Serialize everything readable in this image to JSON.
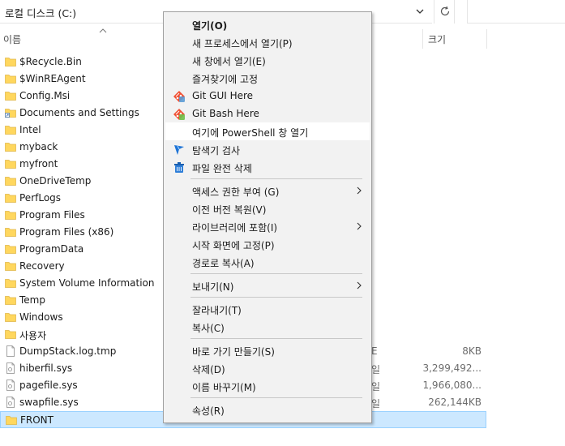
{
  "address": {
    "path": "로컬 디스크 (C:)"
  },
  "columns": {
    "name": "이름",
    "size": "크기"
  },
  "files": [
    {
      "name": "$Recycle.Bin",
      "kind": "folder"
    },
    {
      "name": "$WinREAgent",
      "kind": "folder"
    },
    {
      "name": "Config.Msi",
      "kind": "folder"
    },
    {
      "name": "Documents and Settings",
      "kind": "shortcut-folder"
    },
    {
      "name": "Intel",
      "kind": "folder"
    },
    {
      "name": "myback",
      "kind": "folder"
    },
    {
      "name": "myfront",
      "kind": "folder"
    },
    {
      "name": "OneDriveTemp",
      "kind": "folder"
    },
    {
      "name": "PerfLogs",
      "kind": "folder"
    },
    {
      "name": "Program Files",
      "kind": "folder"
    },
    {
      "name": "Program Files (x86)",
      "kind": "folder"
    },
    {
      "name": "ProgramData",
      "kind": "folder"
    },
    {
      "name": "Recovery",
      "kind": "folder"
    },
    {
      "name": "System Volume Information",
      "kind": "folder"
    },
    {
      "name": "Temp",
      "kind": "folder"
    },
    {
      "name": "Windows",
      "kind": "folder"
    },
    {
      "name": "사용자",
      "kind": "folder"
    },
    {
      "name": "DumpStack.log.tmp",
      "kind": "file",
      "type": "E",
      "size": "8KB"
    },
    {
      "name": "hiberfil.sys",
      "kind": "sysfile",
      "type": "일",
      "size": "3,299,492..."
    },
    {
      "name": "pagefile.sys",
      "kind": "sysfile",
      "type": "일",
      "size": "1,966,080..."
    },
    {
      "name": "swapfile.sys",
      "kind": "sysfile",
      "type": "일",
      "size": "262,144KB"
    },
    {
      "name": "FRONT",
      "kind": "folder",
      "selected": true
    }
  ],
  "context_menu": {
    "items": [
      {
        "label": "열기(O)",
        "bold": true
      },
      {
        "label": "새 프로세스에서 열기(P)"
      },
      {
        "label": "새 창에서 열기(E)"
      },
      {
        "label": "즐겨찾기에 고정"
      },
      {
        "label": "Git GUI Here",
        "icon": "git-gui-icon"
      },
      {
        "label": "Git Bash Here",
        "icon": "git-bash-icon"
      },
      {
        "label": "여기에 PowerShell 창 열기",
        "hover": true
      },
      {
        "label": "탐색기 검사",
        "icon": "scan-icon"
      },
      {
        "label": "파일 완전 삭제",
        "icon": "shred-icon"
      },
      {
        "sep": true
      },
      {
        "label": "액세스 권한 부여 (G)",
        "submenu": true
      },
      {
        "label": "이전 버전 복원(V)"
      },
      {
        "label": "라이브러리에 포함(I)",
        "submenu": true
      },
      {
        "label": "시작 화면에 고정(P)"
      },
      {
        "label": "경로로 복사(A)"
      },
      {
        "sep": true
      },
      {
        "label": "보내기(N)",
        "submenu": true
      },
      {
        "sep": true
      },
      {
        "label": "잘라내기(T)"
      },
      {
        "label": "복사(C)"
      },
      {
        "sep": true
      },
      {
        "label": "바로 가기 만들기(S)"
      },
      {
        "label": "삭제(D)"
      },
      {
        "label": "이름 바꾸기(M)"
      },
      {
        "sep": true
      },
      {
        "label": "속성(R)"
      }
    ]
  },
  "colors": {
    "selection": "#cce8ff",
    "selection_border": "#99d1ff",
    "folder": "#ffd75e",
    "menu_bg": "#f2f2f2"
  }
}
